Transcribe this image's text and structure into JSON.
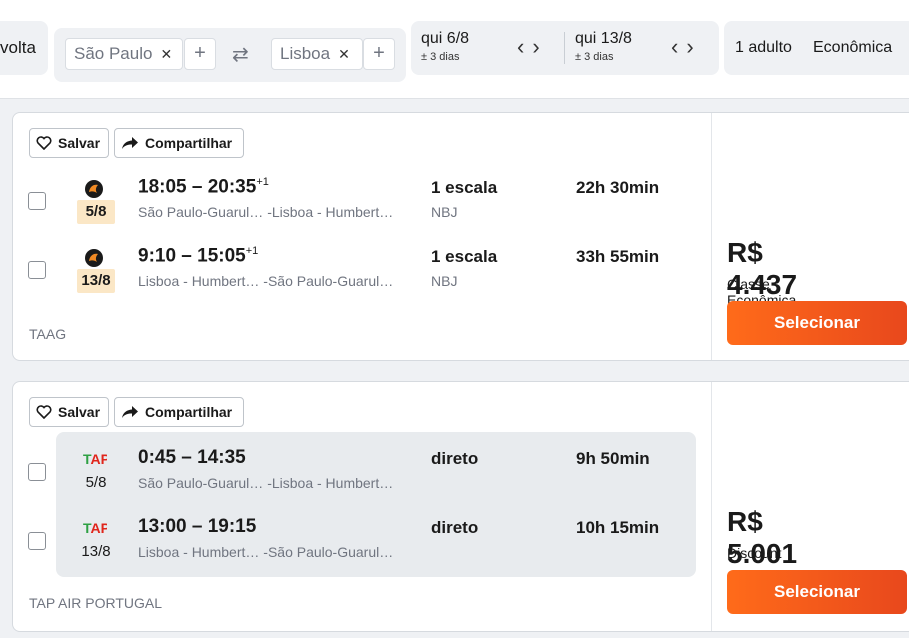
{
  "search": {
    "trip_type": "volta",
    "origin": "São Paulo",
    "destination": "Lisboa",
    "depart_date": "qui 6/8",
    "depart_flex": "± 3 dias",
    "return_date": "qui 13/8",
    "return_flex": "± 3 dias",
    "passengers": "1 adulto",
    "cabin": "Econômica"
  },
  "actions": {
    "save": "Salvar",
    "share": "Compartilhar",
    "select": "Selecionar"
  },
  "results": [
    {
      "legs": [
        {
          "date": "5/8",
          "times": "18:05 – 20:35",
          "plus": "+1",
          "route_from": "São Paulo-Guarul…",
          "route_to": "-Lisboa - Humbert…",
          "stops": "1 escala",
          "via": "NBJ",
          "duration": "22h 30min"
        },
        {
          "date": "13/8",
          "times": "9:10 – 15:05",
          "plus": "+1",
          "route_from": "Lisboa - Humbert…",
          "route_to": "-São Paulo-Guarul…",
          "stops": "1 escala",
          "via": "NBJ",
          "duration": "33h 55min"
        }
      ],
      "airline": "TAAG",
      "price": "R$ 4.437",
      "cabin_label": "Classe Econômica"
    },
    {
      "legs": [
        {
          "date": "5/8",
          "times": "0:45 – 14:35",
          "route_from": "São Paulo-Guarul…",
          "route_to": "-Lisboa - Humbert…",
          "stops": "direto",
          "duration": "9h 50min"
        },
        {
          "date": "13/8",
          "times": "13:00 – 19:15",
          "route_from": "Lisboa - Humbert…",
          "route_to": "-São Paulo-Guarul…",
          "stops": "direto",
          "duration": "10h 15min"
        }
      ],
      "airline": "TAP AIR PORTUGAL",
      "logo_text": "TAP",
      "price": "R$ 5.001",
      "cabin_label": "Discount"
    }
  ],
  "colors": {
    "accent": "#ff6b1a",
    "date_highlight": "#fbe7c6",
    "tap_green": "#2ea043",
    "tap_red": "#e0261c"
  }
}
